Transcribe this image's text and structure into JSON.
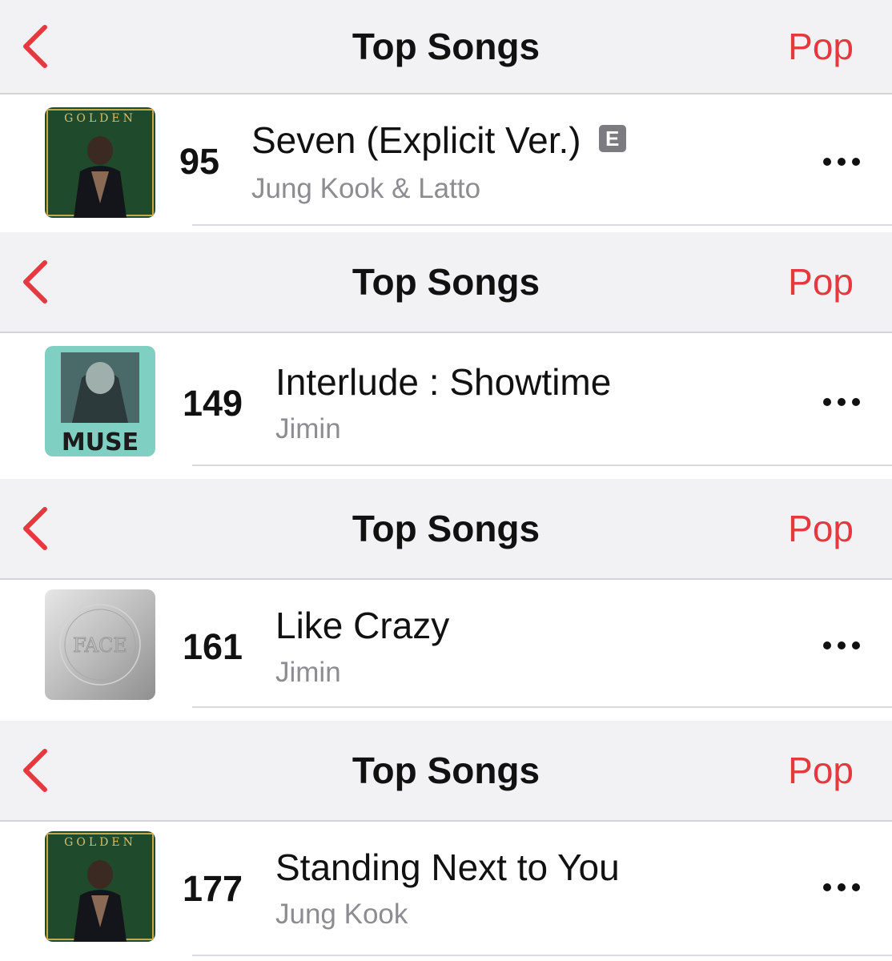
{
  "panels": [
    {
      "header": {
        "title": "Top Songs",
        "genre": "Pop"
      },
      "song": {
        "rank": "95",
        "title": "Seven (Explicit Ver.)",
        "explicit_badge": "E",
        "artist": "Jung Kook & Latto",
        "album_art_text": "GOLDEN"
      }
    },
    {
      "header": {
        "title": "Top Songs",
        "genre": "Pop"
      },
      "song": {
        "rank": "149",
        "title": "Interlude : Showtime",
        "explicit_badge": "",
        "artist": "Jimin",
        "album_art_text": "MUSE"
      }
    },
    {
      "header": {
        "title": "Top Songs",
        "genre": "Pop"
      },
      "song": {
        "rank": "161",
        "title": "Like Crazy",
        "explicit_badge": "",
        "artist": "Jimin",
        "album_art_text": "FACE"
      }
    },
    {
      "header": {
        "title": "Top Songs",
        "genre": "Pop"
      },
      "song": {
        "rank": "177",
        "title": "Standing Next to You",
        "explicit_badge": "",
        "artist": "Jung Kook",
        "album_art_text": "GOLDEN"
      }
    }
  ],
  "colors": {
    "accent": "#e5383f",
    "header_bg": "#f2f2f4",
    "secondary_text": "#8c8c91"
  }
}
